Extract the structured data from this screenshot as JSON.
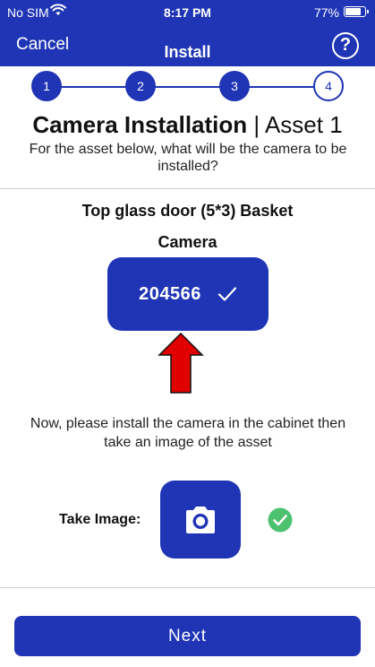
{
  "status_bar": {
    "carrier": "No SIM",
    "time": "8:17 PM",
    "battery": "77%",
    "icons": [
      "wifi-icon",
      "battery-icon"
    ]
  },
  "nav": {
    "cancel_label": "Cancel",
    "title": "Install",
    "help_label": "?"
  },
  "stepper": {
    "steps": [
      "1",
      "2",
      "3",
      "4"
    ],
    "current_step": "4"
  },
  "header": {
    "title_bold": "Camera Installation",
    "title_separator": " | ",
    "title_rest": "Asset 1",
    "subtitle": "For the asset below, what will be the  camera to be installed?"
  },
  "asset": {
    "name": "Top glass door (5*3) Basket",
    "camera_label": "Camera",
    "camera_code": "204566"
  },
  "instructions": "Now, please install the camera in the cabinet then take an image of the asset",
  "take_image": {
    "label": "Take Image:"
  },
  "footer": {
    "next_label": "Next"
  },
  "colors": {
    "primary": "#1f35b5",
    "arrow": "#e00000",
    "success": "#4cc16e"
  }
}
